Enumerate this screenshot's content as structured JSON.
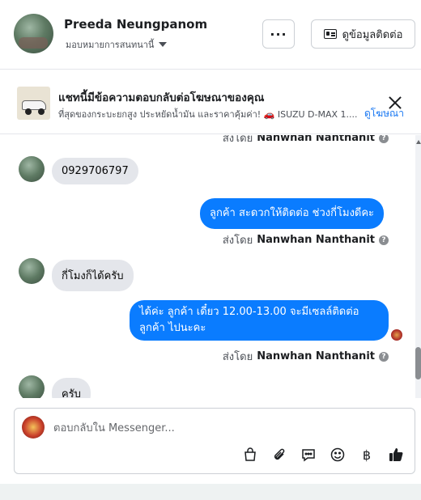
{
  "header": {
    "contact_name": "Preeda Neungpanom",
    "assign_label": "มอบหมายการสนทนานี้",
    "more_label": "···",
    "contact_info_label": "ดูข้อมูลติดต่อ"
  },
  "ad_banner": {
    "title": "แชทนี้มีข้อความตอบกลับต่อโฆษณาของคุณ",
    "subtitle": "ที่สุดของกระบะยกสูง ประหยัดน้ำมัน และราคาคุ้มค่า! 🚗 ISUZU D-MAX 1....",
    "link_label": "ดูโฆษณา"
  },
  "chat": {
    "sent_by_prefix": "ส่งโดย",
    "agent_name": "Nanwhan Nanthanit",
    "messages": [
      {
        "from": "customer",
        "text": "0929706797"
      },
      {
        "from": "page",
        "text": "ลูกค้า  สะดวกให้ติดต่อ ช่วงกี่โมงดีคะ"
      },
      {
        "from": "customer",
        "text": "กี่โมงก็ได้ครับ"
      },
      {
        "from": "page",
        "text_line1": "ได้ค่ะ  ลูกค้า   เดี๋ยว 12.00-13.00 จะมีเซลล์ติดต่อ",
        "text_line2": "ลูกค้า ไปนะคะ"
      },
      {
        "from": "customer",
        "text": "ครับ"
      }
    ]
  },
  "composer": {
    "placeholder": "ตอบกลับใน Messenger..."
  },
  "icons": {
    "bag": "shopping-bag-icon",
    "attach": "paperclip-icon",
    "saved_reply": "chat-bubble-icon",
    "emoji": "smiley-icon",
    "currency": "baht-icon",
    "like": "thumbs-up-icon"
  },
  "colors": {
    "outgoing_bubble": "#0a7cff",
    "incoming_bubble": "#e4e6eb",
    "link": "#1877f2"
  }
}
